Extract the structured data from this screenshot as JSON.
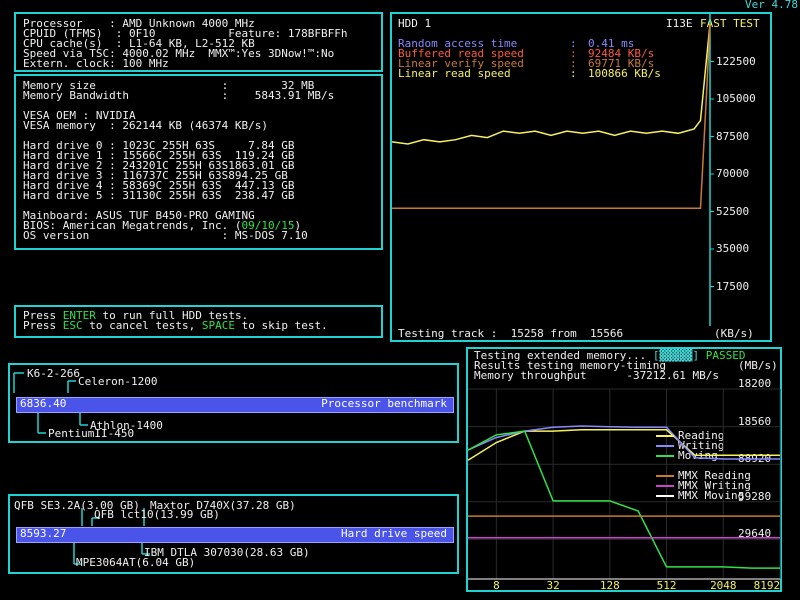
{
  "version": "Ver 4.78",
  "cpu_info": {
    "processor": "Processor    : AMD Unknown 4000 MHz",
    "cpuid": "CPUID (TFMS)  : 0F10           Feature: 178BFBFFh",
    "cache": "CPU cache(s)  : L1-64 KB, L2-512 KB",
    "speed": "Speed via TSC: 4000.02 MHz  MMX™:Yes 3DNow!™:No",
    "extern": "Extern. clock: 100 MHz"
  },
  "system_info": {
    "memory_size": "Memory size                   :        32 MB",
    "memory_bw": "Memory Bandwidth              :    5843.91 MB/s",
    "vesa_oem": "VESA OEM : NVIDIA",
    "vesa_mem": "VESA memory  : 262144 KB (46374 KB/s)",
    "hdd0": "Hard drive 0 : 1023C 255H 63S     7.84 GB",
    "hdd1": "Hard drive 1 : 15566C 255H 63S  119.24 GB",
    "hdd2": "Hard drive 2 : 243201C 255H 63S1863.01 GB",
    "hdd3": "Hard drive 3 : 116737C 255H 63S894.25 GB",
    "hdd4": "Hard drive 4 : 58369C 255H 63S  447.13 GB",
    "hdd5": "Hard drive 5 : 31130C 255H 63S  238.47 GB",
    "mainboard": "Mainboard: ASUS TUF B450-PRO GAMING",
    "bios_prefix": "BIOS: American Megatrends, Inc. (",
    "bios_date": "09/10/15",
    "bios_suffix": ")",
    "os": "OS version                    : MS-DOS 7.10"
  },
  "instructions": {
    "line1_a": "Press ",
    "line1_key": "ENTER",
    "line1_b": " to run full HDD tests.",
    "line2_a": "Press ",
    "line2_key": "ESC",
    "line2_b": " to cancel tests, ",
    "line2_key2": "SPACE",
    "line2_c": " to skip test."
  },
  "hdd_chart": {
    "title": "HDD 1",
    "drive_id": "I13E",
    "mode": "FAST TEST",
    "legend": [
      {
        "label": "Random access time  ",
        "sep": ":",
        "value": "0.41 ms",
        "color": "#8888ff"
      },
      {
        "label": "Buffered read speed ",
        "sep": ":",
        "value": "92484 KB/s",
        "color": "#ff5a3c"
      },
      {
        "label": "Linear verify speed ",
        "sep": ":",
        "value": "69771 KB/s",
        "color": "#c87a33"
      },
      {
        "label": "Linear read speed   ",
        "sep": ":",
        "value": "100866 KB/s",
        "color": "#f6f15f"
      }
    ],
    "yticks": [
      "122500",
      "105000",
      "87500",
      "70000",
      "52500",
      "35000",
      "17500"
    ],
    "footer_a": "Testing track :  15258 from  15566",
    "footer_unit": "(KB/s)"
  },
  "mem_chart": {
    "status_a": "Testing extended memory...",
    "status_passed": "PASSED",
    "status_b": "Results testing memory-timing",
    "status_b_unit": "(MB/s)",
    "status_c": "Memory throughput      -37212.61 MB/s",
    "yticks": [
      "18200",
      "18560",
      "88920",
      "59280",
      "29640"
    ],
    "xticks": [
      "8",
      "32",
      "128",
      "512",
      "2048",
      "8192"
    ],
    "legend": [
      {
        "label": "Reading",
        "color": "#f6f15f"
      },
      {
        "label": "Writing",
        "color": "#8888ff"
      },
      {
        "label": "Moving",
        "color": "#34e049"
      },
      {
        "label": "MMX Reading",
        "color": "#c87a33"
      },
      {
        "label": "MMX Writing",
        "color": "#cc44cc"
      },
      {
        "label": "MMX Moving",
        "color": "#ffffff"
      }
    ]
  },
  "cpu_bench": {
    "value": "6836.40",
    "label": "Processor benchmark",
    "refs": [
      "K6-2-266",
      "Celeron-1200",
      "Athlon-1400",
      "PentiumII-450"
    ]
  },
  "hdd_bench": {
    "value": "8593.27",
    "label": "Hard drive speed",
    "refs": [
      "QFB SE3.2A(3.00 GB)",
      "Maxtor D740X(37.28 GB)",
      "QFB lct10(13.99 GB)",
      "IBM DTLA 307030(28.63 GB)",
      "MPE3064AT(6.04 GB)"
    ]
  },
  "chart_data": [
    {
      "type": "line",
      "title": "HDD 1",
      "ylabel": "(KB/s)",
      "ylim": [
        0,
        140000
      ],
      "x": [
        0,
        0.05,
        0.1,
        0.15,
        0.2,
        0.25,
        0.3,
        0.35,
        0.4,
        0.45,
        0.5,
        0.55,
        0.6,
        0.65,
        0.7,
        0.75,
        0.8,
        0.85,
        0.9,
        0.95,
        0.97,
        0.99,
        1.0
      ],
      "series": [
        {
          "name": "Linear read speed",
          "values": [
            85000,
            84000,
            86000,
            85000,
            86000,
            88000,
            87000,
            90000,
            89000,
            90000,
            88000,
            90000,
            89000,
            90000,
            88000,
            90000,
            89000,
            90000,
            89000,
            91000,
            95000,
            125000,
            140000
          ]
        },
        {
          "name": "Linear verify speed",
          "values": [
            54000,
            54000,
            54000,
            54000,
            54000,
            54000,
            54000,
            54000,
            54000,
            54000,
            54000,
            54000,
            54000,
            54000,
            54000,
            54000,
            54000,
            54000,
            54000,
            54000,
            54000,
            110000,
            140000
          ]
        }
      ]
    },
    {
      "type": "line",
      "ylabel": "(MB/s)",
      "x_categories": [
        "8",
        "32",
        "128",
        "512",
        "2048",
        "8192"
      ],
      "ylim": [
        0,
        148200
      ],
      "x": [
        4,
        8,
        16,
        32,
        64,
        128,
        256,
        512,
        1024,
        2048,
        4096,
        8192
      ],
      "series": [
        {
          "name": "Reading",
          "values": [
            92000,
            106000,
            115000,
            115000,
            116000,
            116000,
            116000,
            116000,
            96000,
            96000,
            96000,
            96000
          ]
        },
        {
          "name": "Writing",
          "values": [
            100000,
            110000,
            115000,
            118000,
            119000,
            118500,
            118000,
            118000,
            94000,
            93000,
            93000,
            93000
          ]
        },
        {
          "name": "Moving",
          "values": [
            100000,
            112000,
            115000,
            60000,
            60000,
            60000,
            52000,
            8000,
            8000,
            8000,
            7000,
            7000
          ]
        },
        {
          "name": "MMX Reading",
          "values": [
            48000,
            48000,
            48000,
            48000,
            48000,
            48000,
            48000,
            48000,
            48000,
            48000,
            48000,
            48000
          ]
        },
        {
          "name": "MMX Writing",
          "values": [
            31000,
            31000,
            31000,
            31000,
            31000,
            31000,
            31000,
            31000,
            31000,
            31000,
            31000,
            31000
          ]
        },
        {
          "name": "MMX Moving",
          "values": []
        }
      ]
    }
  ]
}
